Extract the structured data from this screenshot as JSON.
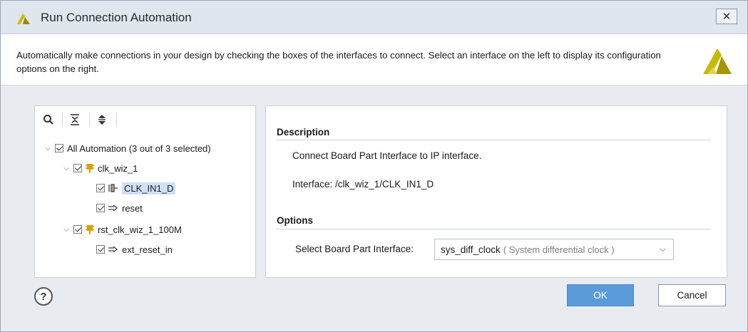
{
  "window": {
    "title": "Run Connection Automation",
    "close_icon": "close-icon"
  },
  "header": {
    "description": "Automatically make connections in your design by checking the boxes of the interfaces to connect. Select an interface on the left to display its configuration options on the right."
  },
  "toolbar": {
    "icons": [
      "search-icon",
      "collapse-all-icon",
      "expand-all-icon"
    ]
  },
  "tree": {
    "root": {
      "label": "All Automation (3 out of 3 selected)",
      "checked": true,
      "expanded": true
    },
    "nodes": [
      {
        "label": "clk_wiz_1",
        "checked": true,
        "expanded": true,
        "icon": "ip-block-icon"
      },
      {
        "label": "CLK_IN1_D",
        "checked": true,
        "icon": "diff-clock-icon",
        "selected": true
      },
      {
        "label": "reset",
        "checked": true,
        "icon": "reset-port-icon"
      },
      {
        "label": "rst_clk_wiz_1_100M",
        "checked": true,
        "expanded": true,
        "icon": "ip-block-icon"
      },
      {
        "label": "ext_reset_in",
        "checked": true,
        "icon": "reset-port-icon"
      }
    ]
  },
  "details": {
    "description_title": "Description",
    "description_text": "Connect Board Part Interface to IP interface.",
    "interface_text": "Interface: /clk_wiz_1/CLK_IN1_D",
    "options_title": "Options",
    "select_label": "Select Board Part Interface:",
    "select_value": "sys_diff_clock",
    "select_desc": "( System differential clock )"
  },
  "footer": {
    "ok_label": "OK",
    "cancel_label": "Cancel",
    "help_label": "?"
  },
  "colors": {
    "ok_button": "#5b9bd9",
    "selected_row": "#cfe0f5",
    "logo": "#c9b800"
  }
}
